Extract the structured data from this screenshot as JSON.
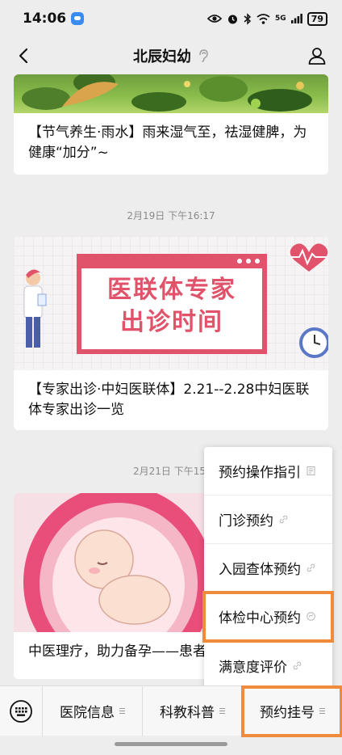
{
  "status_bar": {
    "time": "14:06",
    "network": "5G",
    "battery": "79"
  },
  "nav": {
    "title": "北辰妇幼"
  },
  "feed": {
    "article1": {
      "title": "【节气养生·雨水】雨来湿气至，祛湿健脾，为健康“加分”~"
    },
    "timestamp2": "2月19日 下午16:17",
    "article2": {
      "banner_line1": "医联体专家",
      "banner_line2": "出诊时间",
      "title": "【专家出诊·中妇医联体】2.21--2.28中妇医联体专家出诊一览"
    },
    "timestamp3": "2月21日 下午15:",
    "article3": {
      "title": "中医理疗，助力备孕——患者"
    }
  },
  "popup_menu": {
    "items": [
      {
        "label": "预约操作指引",
        "icon": "document-icon"
      },
      {
        "label": "门诊预约",
        "icon": "link-icon"
      },
      {
        "label": "入园查体预约",
        "icon": "link-icon"
      },
      {
        "label": "体检中心预约",
        "icon": "miniprogram-icon"
      },
      {
        "label": "满意度评价",
        "icon": "link-icon"
      }
    ],
    "highlighted_index": 3
  },
  "bottom_menu": {
    "items": [
      "医院信息",
      "科教科普",
      "预约挂号"
    ],
    "highlighted_index": 2
  },
  "colors": {
    "highlight": "#f08a3c",
    "banner_pink": "#e0536b"
  }
}
